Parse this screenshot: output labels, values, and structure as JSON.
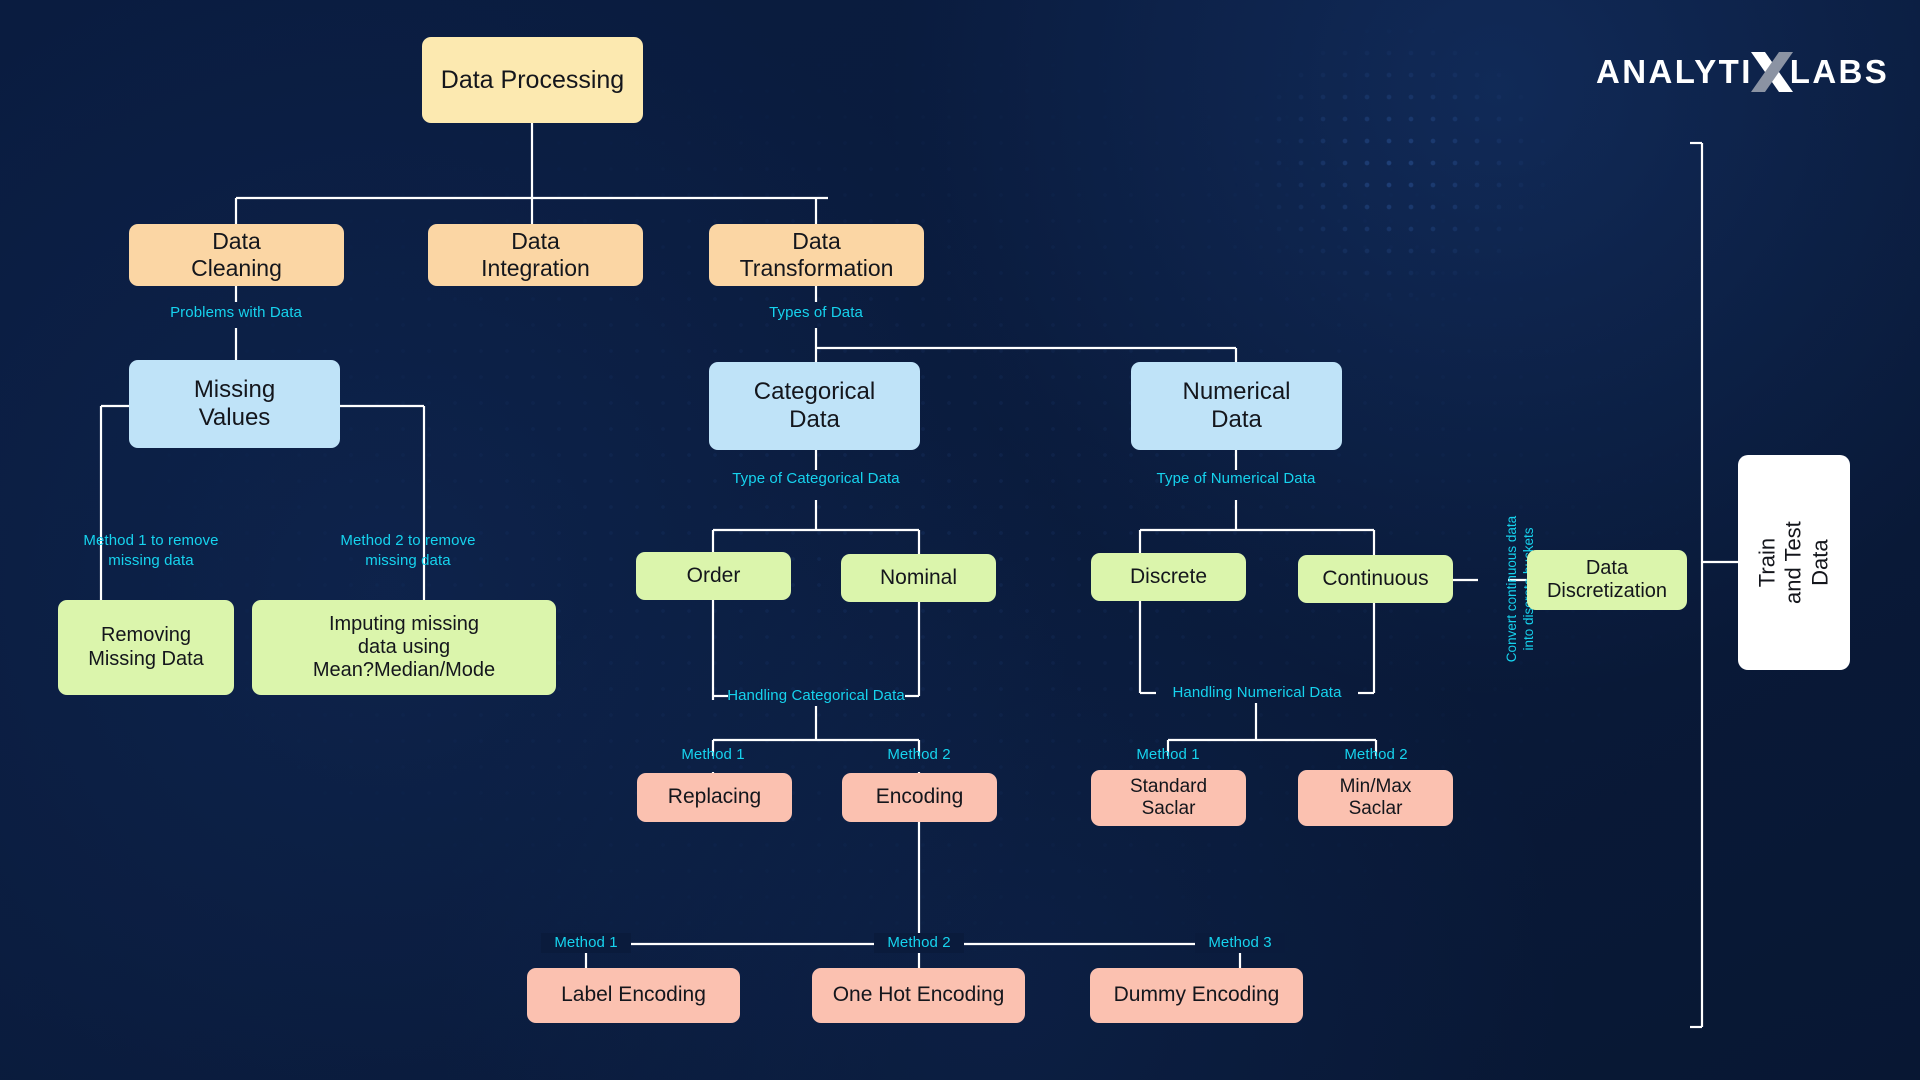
{
  "brand": {
    "name_part1": "ANALYTI",
    "name_x": "X",
    "name_part2": "LABS",
    "logo_icon": "x-mark-icon"
  },
  "colors": {
    "background": "#0a1b3c",
    "connector": "#ffffff",
    "label_cyan": "#16d3ee",
    "level1": "#fce9b0",
    "level2": "#fbd6a4",
    "level3": "#bfe3f8",
    "level4": "#dbf5ac",
    "level5": "#fbc1b0",
    "final": "#ffffff"
  },
  "nodes": {
    "root": "Data Processing",
    "data_cleaning": "Data\nCleaning",
    "data_integration": "Data\nIntegration",
    "data_transformation": "Data\nTransformation",
    "missing_values": "Missing\nValues",
    "categorical_data": "Categorical\nData",
    "numerical_data": "Numerical\nData",
    "removing_missing_data": "Removing\nMissing Data",
    "imputing_missing_data": "Imputing missing\ndata using\nMean?Median/Mode",
    "order": "Order",
    "nominal": "Nominal",
    "discrete": "Discrete",
    "continuous": "Continuous",
    "data_discretization": "Data\nDiscretization",
    "replacing": "Replacing",
    "encoding": "Encoding",
    "standard_scalar": "Standard\nSaclar",
    "minmax_scalar": "Min/Max\nSaclar",
    "label_encoding": "Label Encoding",
    "one_hot_encoding": "One Hot Encoding",
    "dummy_encoding": "Dummy Encoding",
    "train_and_test_data": "Train\nand Test Data"
  },
  "edge_labels": {
    "problems_with_data": "Problems with Data",
    "types_of_data": "Types of Data",
    "method1_remove_missing": "Method 1 to remove\nmissing  data",
    "method2_remove_missing": "Method 2 to remove\nmissing  data",
    "type_of_categorical_data": "Type of Categorical Data",
    "type_of_numerical_data": "Type of Numerical Data",
    "handling_categorical_data": "Handling Categorical Data",
    "handling_numerical_data": "Handling Numerical Data",
    "cat_method1": "Method 1",
    "cat_method2": "Method 2",
    "num_method1": "Method 1",
    "num_method2": "Method 2",
    "enc_method1": "Method 1",
    "enc_method2": "Method 2",
    "enc_method3": "Method 3",
    "convert_continuous": "Convert continuous data\ninto discrete buckets"
  }
}
